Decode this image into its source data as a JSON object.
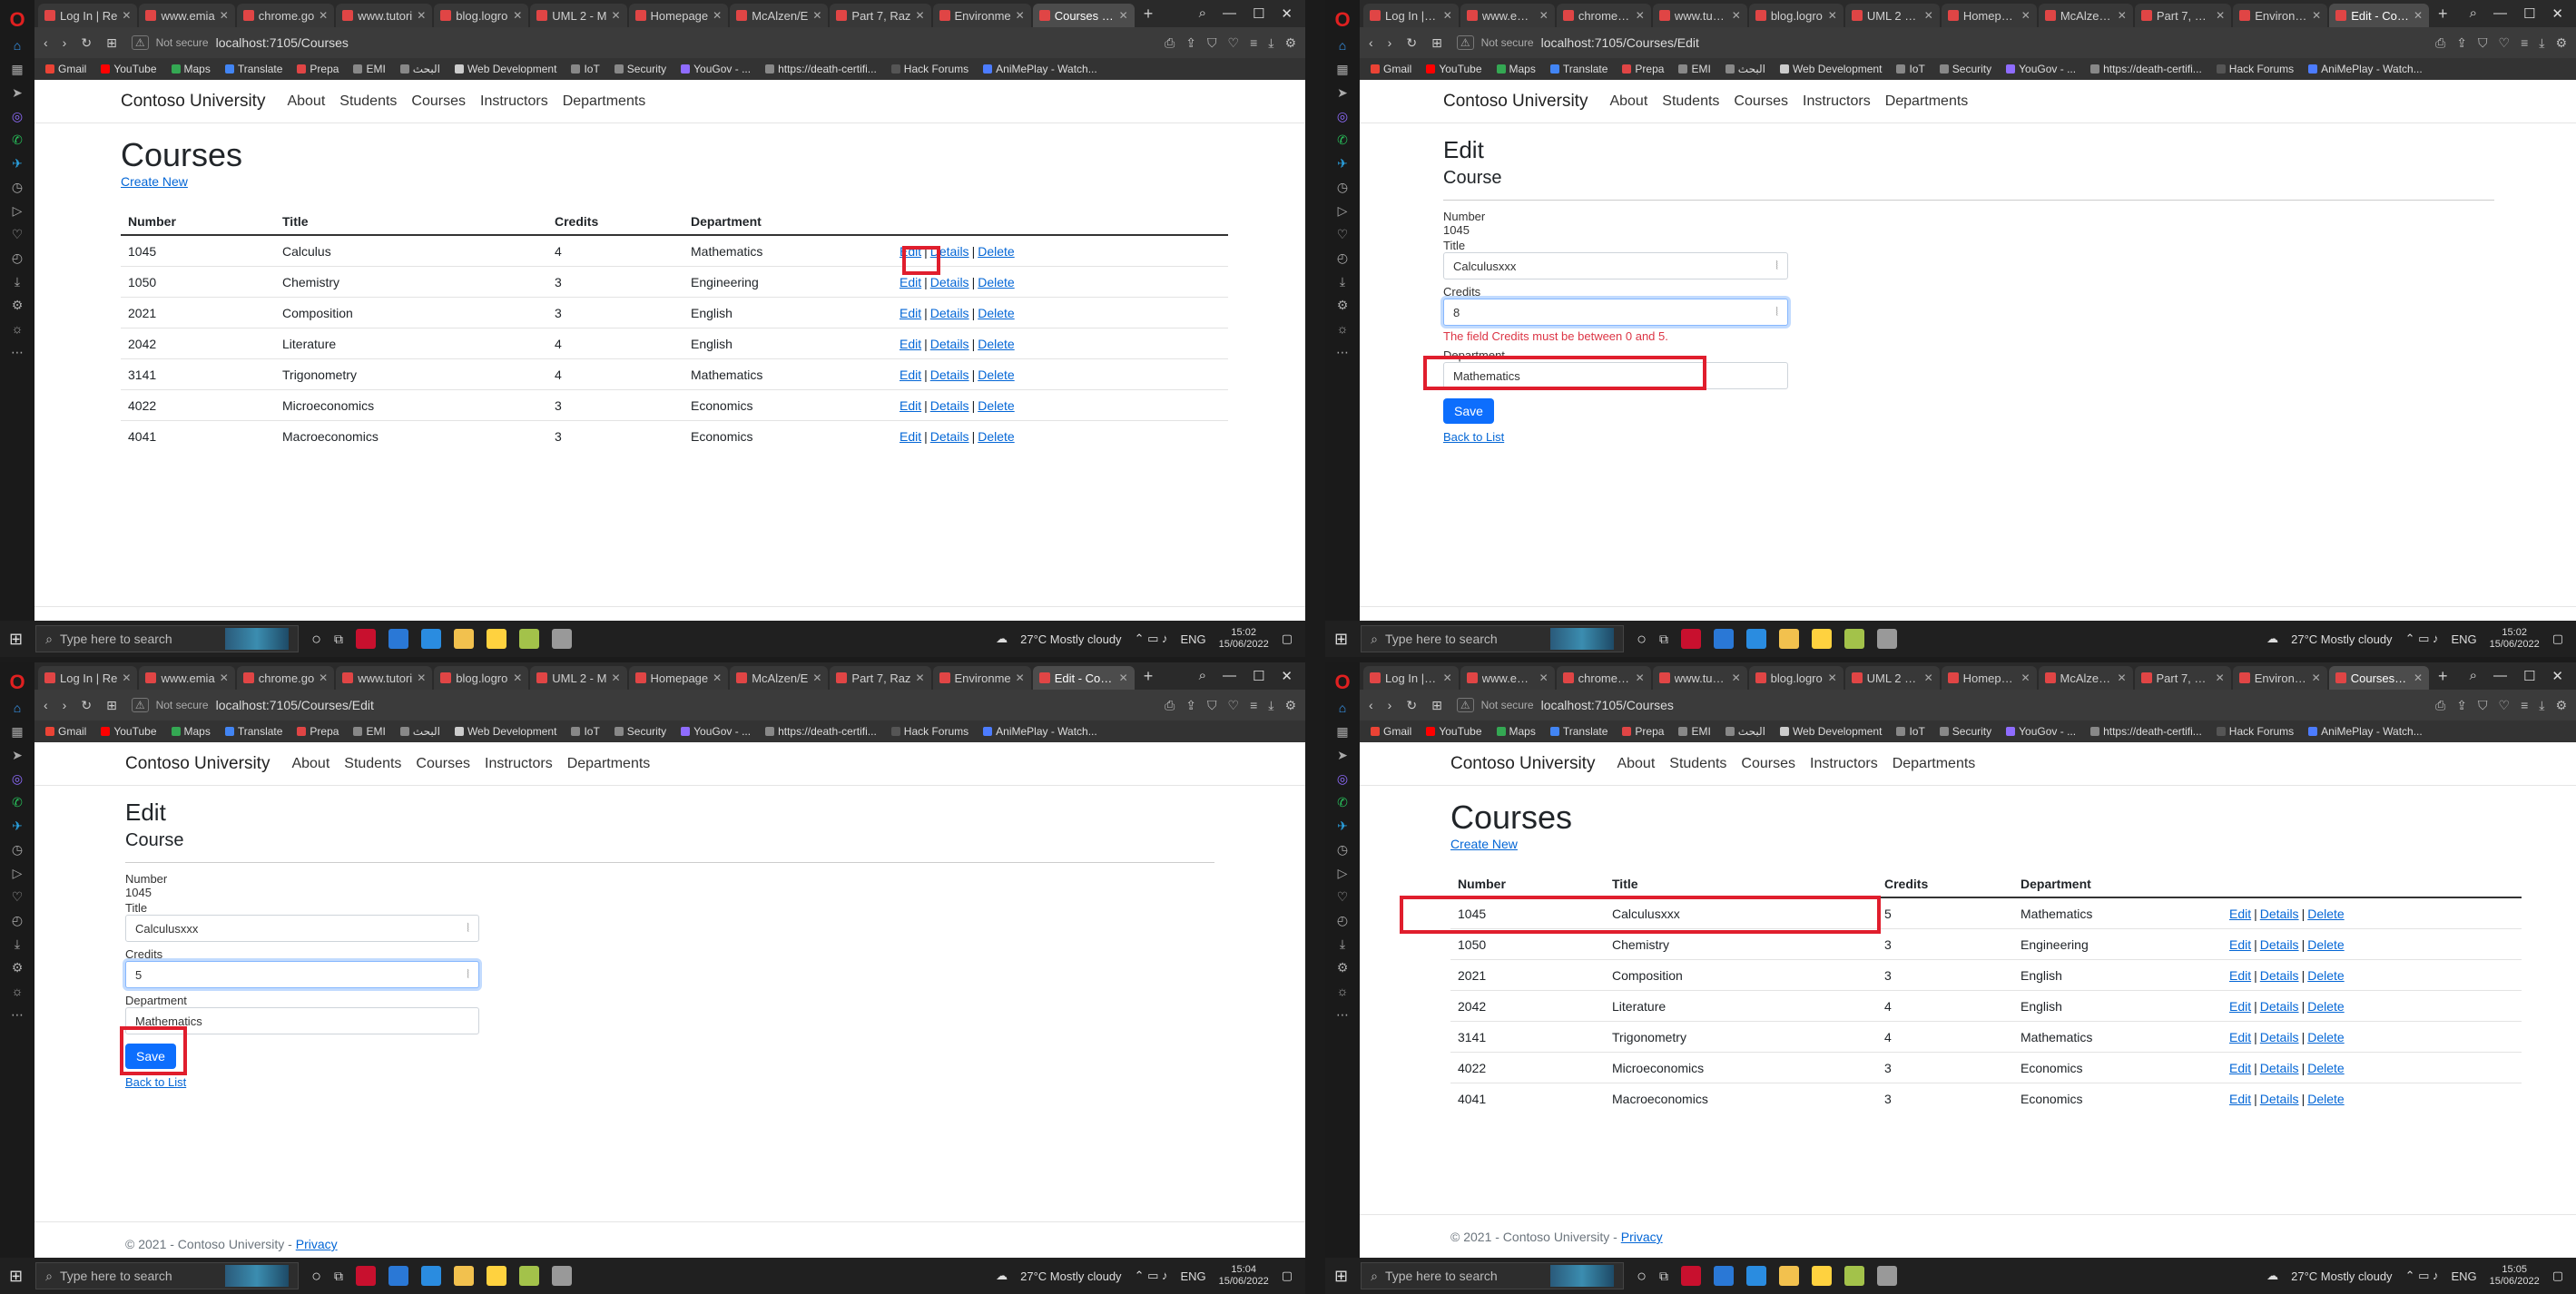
{
  "browser": {
    "tabs": [
      "Log In | Re",
      "www.emia",
      "chrome.go",
      "www.tutori",
      "blog.logro",
      "UML 2 - M",
      "Homepage",
      "McAlzen/E",
      "Part 7, Raz",
      "Environme"
    ],
    "bookmarks": [
      "Gmail",
      "YouTube",
      "Maps",
      "Translate",
      "Prepa",
      "EMI",
      "البحث",
      "Web Development",
      "IoT",
      "Security",
      "YouGov - ...",
      "https://death-certifi...",
      "Hack Forums",
      "AniMePlay - Watch..."
    ],
    "not_secure": "Not secure",
    "window": {
      "min": "—",
      "max": "☐",
      "close": "✕"
    }
  },
  "site": {
    "brand": "Contoso University",
    "nav": [
      "About",
      "Students",
      "Courses",
      "Instructors",
      "Departments"
    ],
    "footer_text": "© 2021 - Contoso University - ",
    "footer_link": "Privacy"
  },
  "q1": {
    "tab_active": "Courses - C",
    "url": "localhost:7105/Courses",
    "title": "Courses",
    "create_new": "Create New",
    "columns": [
      "Number",
      "Title",
      "Credits",
      "Department"
    ],
    "rows": [
      {
        "num": "1045",
        "title": "Calculus",
        "credits": "4",
        "dept": "Mathematics"
      },
      {
        "num": "1050",
        "title": "Chemistry",
        "credits": "3",
        "dept": "Engineering"
      },
      {
        "num": "2021",
        "title": "Composition",
        "credits": "3",
        "dept": "English"
      },
      {
        "num": "2042",
        "title": "Literature",
        "credits": "4",
        "dept": "English"
      },
      {
        "num": "3141",
        "title": "Trigonometry",
        "credits": "4",
        "dept": "Mathematics"
      },
      {
        "num": "4022",
        "title": "Microeconomics",
        "credits": "3",
        "dept": "Economics"
      },
      {
        "num": "4041",
        "title": "Macroeconomics",
        "credits": "3",
        "dept": "Economics"
      }
    ],
    "actions": {
      "edit": "Edit",
      "details": "Details",
      "delete": "Delete",
      "sep": "|"
    }
  },
  "q2": {
    "tab_active": "Edit - Cours",
    "url": "localhost:7105/Courses/Edit",
    "title": "Edit",
    "subtitle": "Course",
    "number_label": "Number",
    "number_value": "1045",
    "title_label": "Title",
    "title_value": "Calculusxxx",
    "credits_label": "Credits",
    "credits_value": "8",
    "error": "The field Credits must be between 0 and 5.",
    "department_label": "Department",
    "department_value": "Mathematics",
    "save": "Save",
    "back": "Back to List"
  },
  "q3": {
    "tab_active": "Edit - Cours",
    "url": "localhost:7105/Courses/Edit",
    "title": "Edit",
    "subtitle": "Course",
    "number_label": "Number",
    "number_value": "1045",
    "title_label": "Title",
    "title_value": "Calculusxxx",
    "credits_label": "Credits",
    "credits_value": "5",
    "department_label": "Department",
    "department_value": "Mathematics",
    "save": "Save",
    "back": "Back to List"
  },
  "q4": {
    "tab_active": "Courses - C",
    "url": "localhost:7105/Courses",
    "title": "Courses",
    "create_new": "Create New",
    "columns": [
      "Number",
      "Title",
      "Credits",
      "Department"
    ],
    "rows": [
      {
        "num": "1045",
        "title": "Calculusxxx",
        "credits": "5",
        "dept": "Mathematics"
      },
      {
        "num": "1050",
        "title": "Chemistry",
        "credits": "3",
        "dept": "Engineering"
      },
      {
        "num": "2021",
        "title": "Composition",
        "credits": "3",
        "dept": "English"
      },
      {
        "num": "2042",
        "title": "Literature",
        "credits": "4",
        "dept": "English"
      },
      {
        "num": "3141",
        "title": "Trigonometry",
        "credits": "4",
        "dept": "Mathematics"
      },
      {
        "num": "4022",
        "title": "Microeconomics",
        "credits": "3",
        "dept": "Economics"
      },
      {
        "num": "4041",
        "title": "Macroeconomics",
        "credits": "3",
        "dept": "Economics"
      }
    ],
    "actions": {
      "edit": "Edit",
      "details": "Details",
      "delete": "Delete",
      "sep": "|"
    }
  },
  "taskbar": {
    "search_placeholder": "Type here to search",
    "weather": "27°C Mostly cloudy",
    "lang": "ENG",
    "time_q1": "15:02",
    "date": "15/06/2022",
    "time_q3": "15:04",
    "time_q4": "15:05"
  },
  "colors": {
    "highlight": "#e01e2d",
    "link": "#0366d6",
    "button": "#0d6efd",
    "error": "#dc3545"
  }
}
